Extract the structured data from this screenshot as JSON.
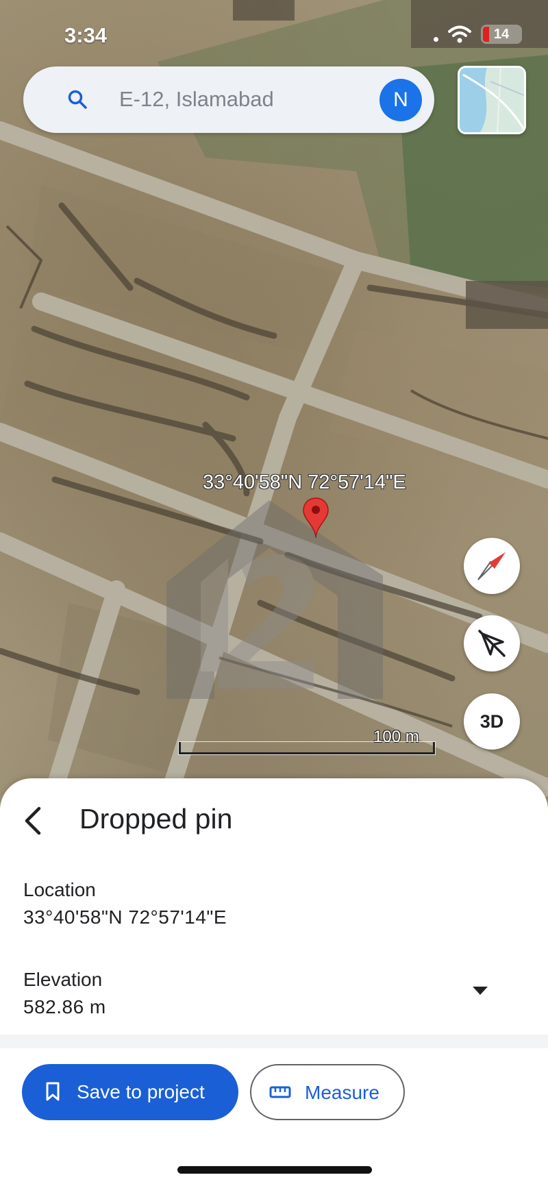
{
  "status_bar": {
    "time": "3:34",
    "battery": "14"
  },
  "search": {
    "placeholder": "E-12, Islamabad",
    "avatar_letter": "N"
  },
  "map": {
    "pin_coordinates": "33°40'58\"N 72°57'14\"E",
    "scale_label": "100 m",
    "button_3d": "3D"
  },
  "sheet": {
    "title": "Dropped pin",
    "location_label": "Location",
    "location_value": "33°40'58\"N 72°57'14\"E",
    "elevation_label": "Elevation",
    "elevation_value": "582.86 m",
    "save_button": "Save to project",
    "measure_button": "Measure"
  },
  "colors": {
    "accent_blue": "#1a5fd6",
    "avatar_blue": "#1a73e8",
    "pin_red": "#e53935"
  },
  "icons": [
    "search-icon",
    "layers-icon",
    "map-pin-icon",
    "compass-icon",
    "tilt-off-icon",
    "back-arrow-icon",
    "dropdown-icon",
    "bookmark-icon",
    "ruler-icon",
    "wifi-icon",
    "battery-icon"
  ]
}
